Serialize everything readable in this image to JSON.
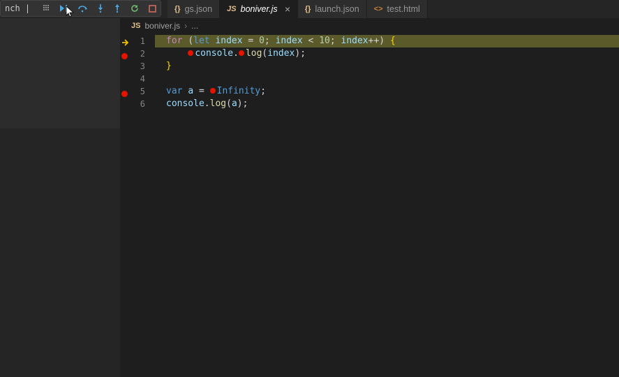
{
  "debugToolbar": {
    "label": "nch |"
  },
  "tabs": [
    {
      "icon": "{}",
      "iconColor": "#e2c08d",
      "name": "gs.json",
      "active": false,
      "closable": false
    },
    {
      "icon": "JS",
      "iconColor": "#e2c08d",
      "name": "boniver.js",
      "active": true,
      "closable": true
    },
    {
      "icon": "{}",
      "iconColor": "#e2c08d",
      "name": "launch.json",
      "active": false,
      "closable": false
    },
    {
      "icon": "<>",
      "iconColor": "#c5823e",
      "name": "test.html",
      "active": false,
      "closable": false
    }
  ],
  "breadcrumb": {
    "fileIcon": "JS",
    "file": "boniver.js",
    "chevron": "›",
    "more": "..."
  },
  "gutter": {
    "lines": [
      {
        "no": "1",
        "marker": "arrow"
      },
      {
        "no": "2",
        "marker": "breakpoint"
      },
      {
        "no": "3",
        "marker": null
      },
      {
        "no": "4",
        "marker": null
      },
      {
        "no": "5",
        "marker": "breakpoint"
      },
      {
        "no": "6",
        "marker": null
      }
    ]
  },
  "code": {
    "tokens": {
      "for": "for",
      "let": "let",
      "index": "index",
      "eq": "=",
      "zero": "0",
      "semi": ";",
      "lt": "<",
      "ten": "10",
      "plusplus": "++",
      "lparen": "(",
      "rparen": ")",
      "lbrace": "{",
      "rbrace": "}",
      "console": "console",
      "dot": ".",
      "log": "log",
      "var": "var",
      "a": "a",
      "Infinity": "Infinity"
    }
  }
}
